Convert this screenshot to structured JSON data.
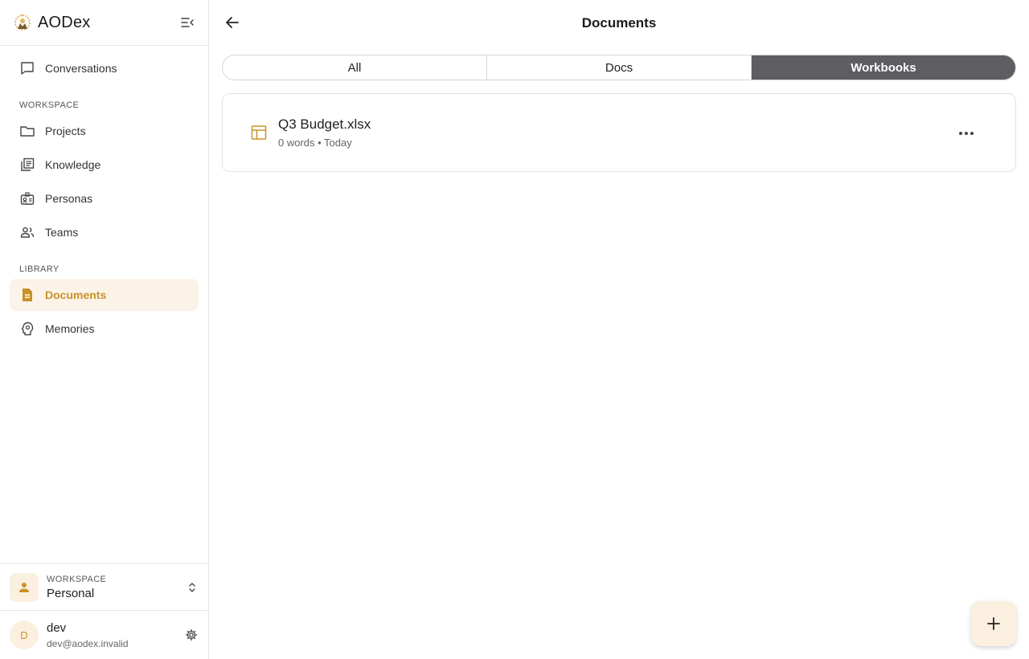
{
  "app": {
    "name": "AODex",
    "accent_color": "#c8922a",
    "accent_bg": "#fbf3e8"
  },
  "sidebar": {
    "top_item": {
      "label": "Conversations",
      "icon": "chat-bubble-icon"
    },
    "sections": [
      {
        "label": "WORKSPACE",
        "items": [
          {
            "label": "Projects",
            "icon": "folder-icon"
          },
          {
            "label": "Knowledge",
            "icon": "library-books-icon"
          },
          {
            "label": "Personas",
            "icon": "persona-badge-icon"
          },
          {
            "label": "Teams",
            "icon": "people-icon"
          }
        ]
      },
      {
        "label": "LIBRARY",
        "items": [
          {
            "label": "Documents",
            "icon": "document-icon",
            "active": true
          },
          {
            "label": "Memories",
            "icon": "brain-icon"
          }
        ]
      }
    ],
    "workspace": {
      "label": "WORKSPACE",
      "name": "Personal"
    },
    "user": {
      "initial": "D",
      "name": "dev",
      "email": "dev@aodex.invalid"
    }
  },
  "main": {
    "title": "Documents",
    "tabs": [
      {
        "label": "All",
        "active": false
      },
      {
        "label": "Docs",
        "active": false
      },
      {
        "label": "Workbooks",
        "active": true
      }
    ],
    "documents": [
      {
        "title": "Q3 Budget.xlsx",
        "meta": "0 words • Today",
        "icon": "spreadsheet-icon"
      }
    ]
  }
}
